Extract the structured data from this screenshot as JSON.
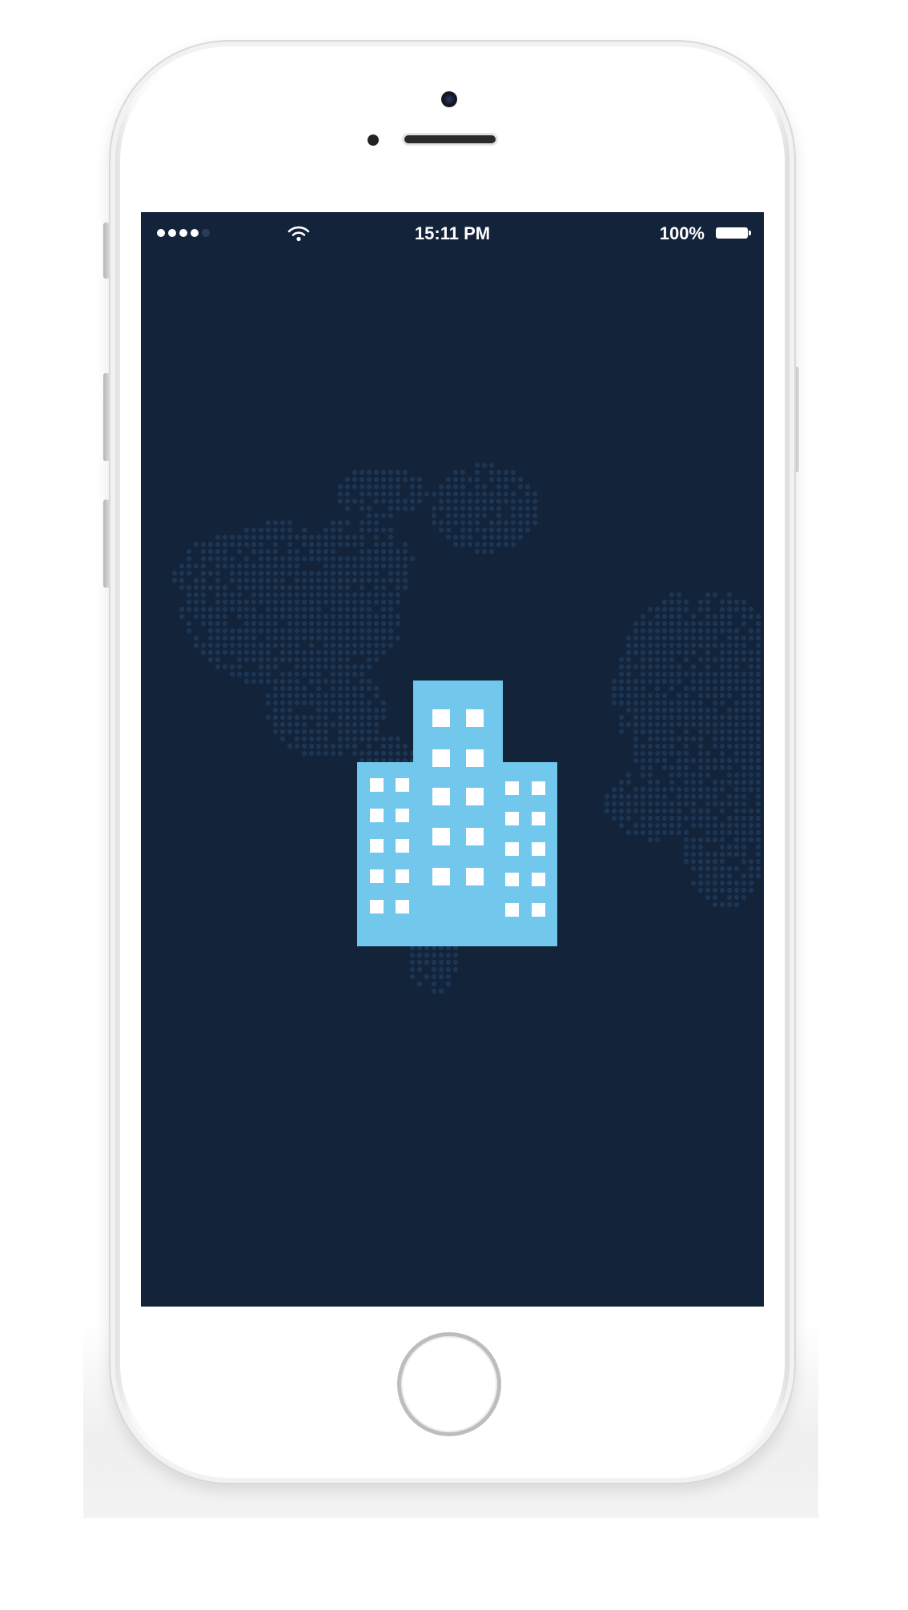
{
  "status_bar": {
    "signal_dots_filled": 4,
    "signal_dots_total": 5,
    "time": "15:11 PM",
    "battery_percent": "100%",
    "icons": [
      "signal-dots-icon",
      "wifi-icon",
      "battery-icon"
    ]
  },
  "splash": {
    "background_color": "#12233a",
    "map_dot_color": "#1c3553",
    "logo": {
      "icon": "office-building-icon",
      "color": "#71c8ec",
      "window_color": "#ffffff"
    }
  },
  "device": {
    "type": "smartphone",
    "color": "#ffffff"
  }
}
